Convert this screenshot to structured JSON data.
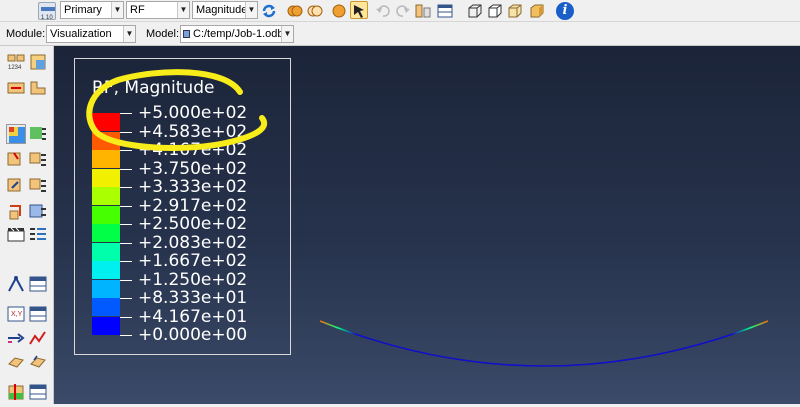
{
  "toolbar": {
    "primary_selector": {
      "value": "Primary"
    },
    "variable_selector": {
      "value": "RF"
    },
    "invariant_selector": {
      "value": "Magnitude"
    },
    "info_label": "i"
  },
  "context_bar": {
    "module_label": "Module:",
    "module_value": "Visualization",
    "model_label": "Model:",
    "model_value": "C:/temp/Job-1.odb"
  },
  "legend": {
    "title": "RF, Magnitude",
    "levels": [
      "+5.000e+02",
      "+4.583e+02",
      "+4.167e+02",
      "+3.750e+02",
      "+3.333e+02",
      "+2.917e+02",
      "+2.500e+02",
      "+2.083e+02",
      "+1.667e+02",
      "+1.250e+02",
      "+8.333e+01",
      "+4.167e+01",
      "+0.000e+00"
    ],
    "colors": [
      "#ff0000",
      "#ff5a00",
      "#ffb400",
      "#f0f000",
      "#aaff00",
      "#46ff00",
      "#00ff46",
      "#00ffaa",
      "#00f0f0",
      "#00b4ff",
      "#005aff",
      "#0000ff"
    ]
  },
  "model_curve": {
    "color": "#1010c8",
    "end_colors": [
      "#ff6a00",
      "#00ff80"
    ]
  }
}
